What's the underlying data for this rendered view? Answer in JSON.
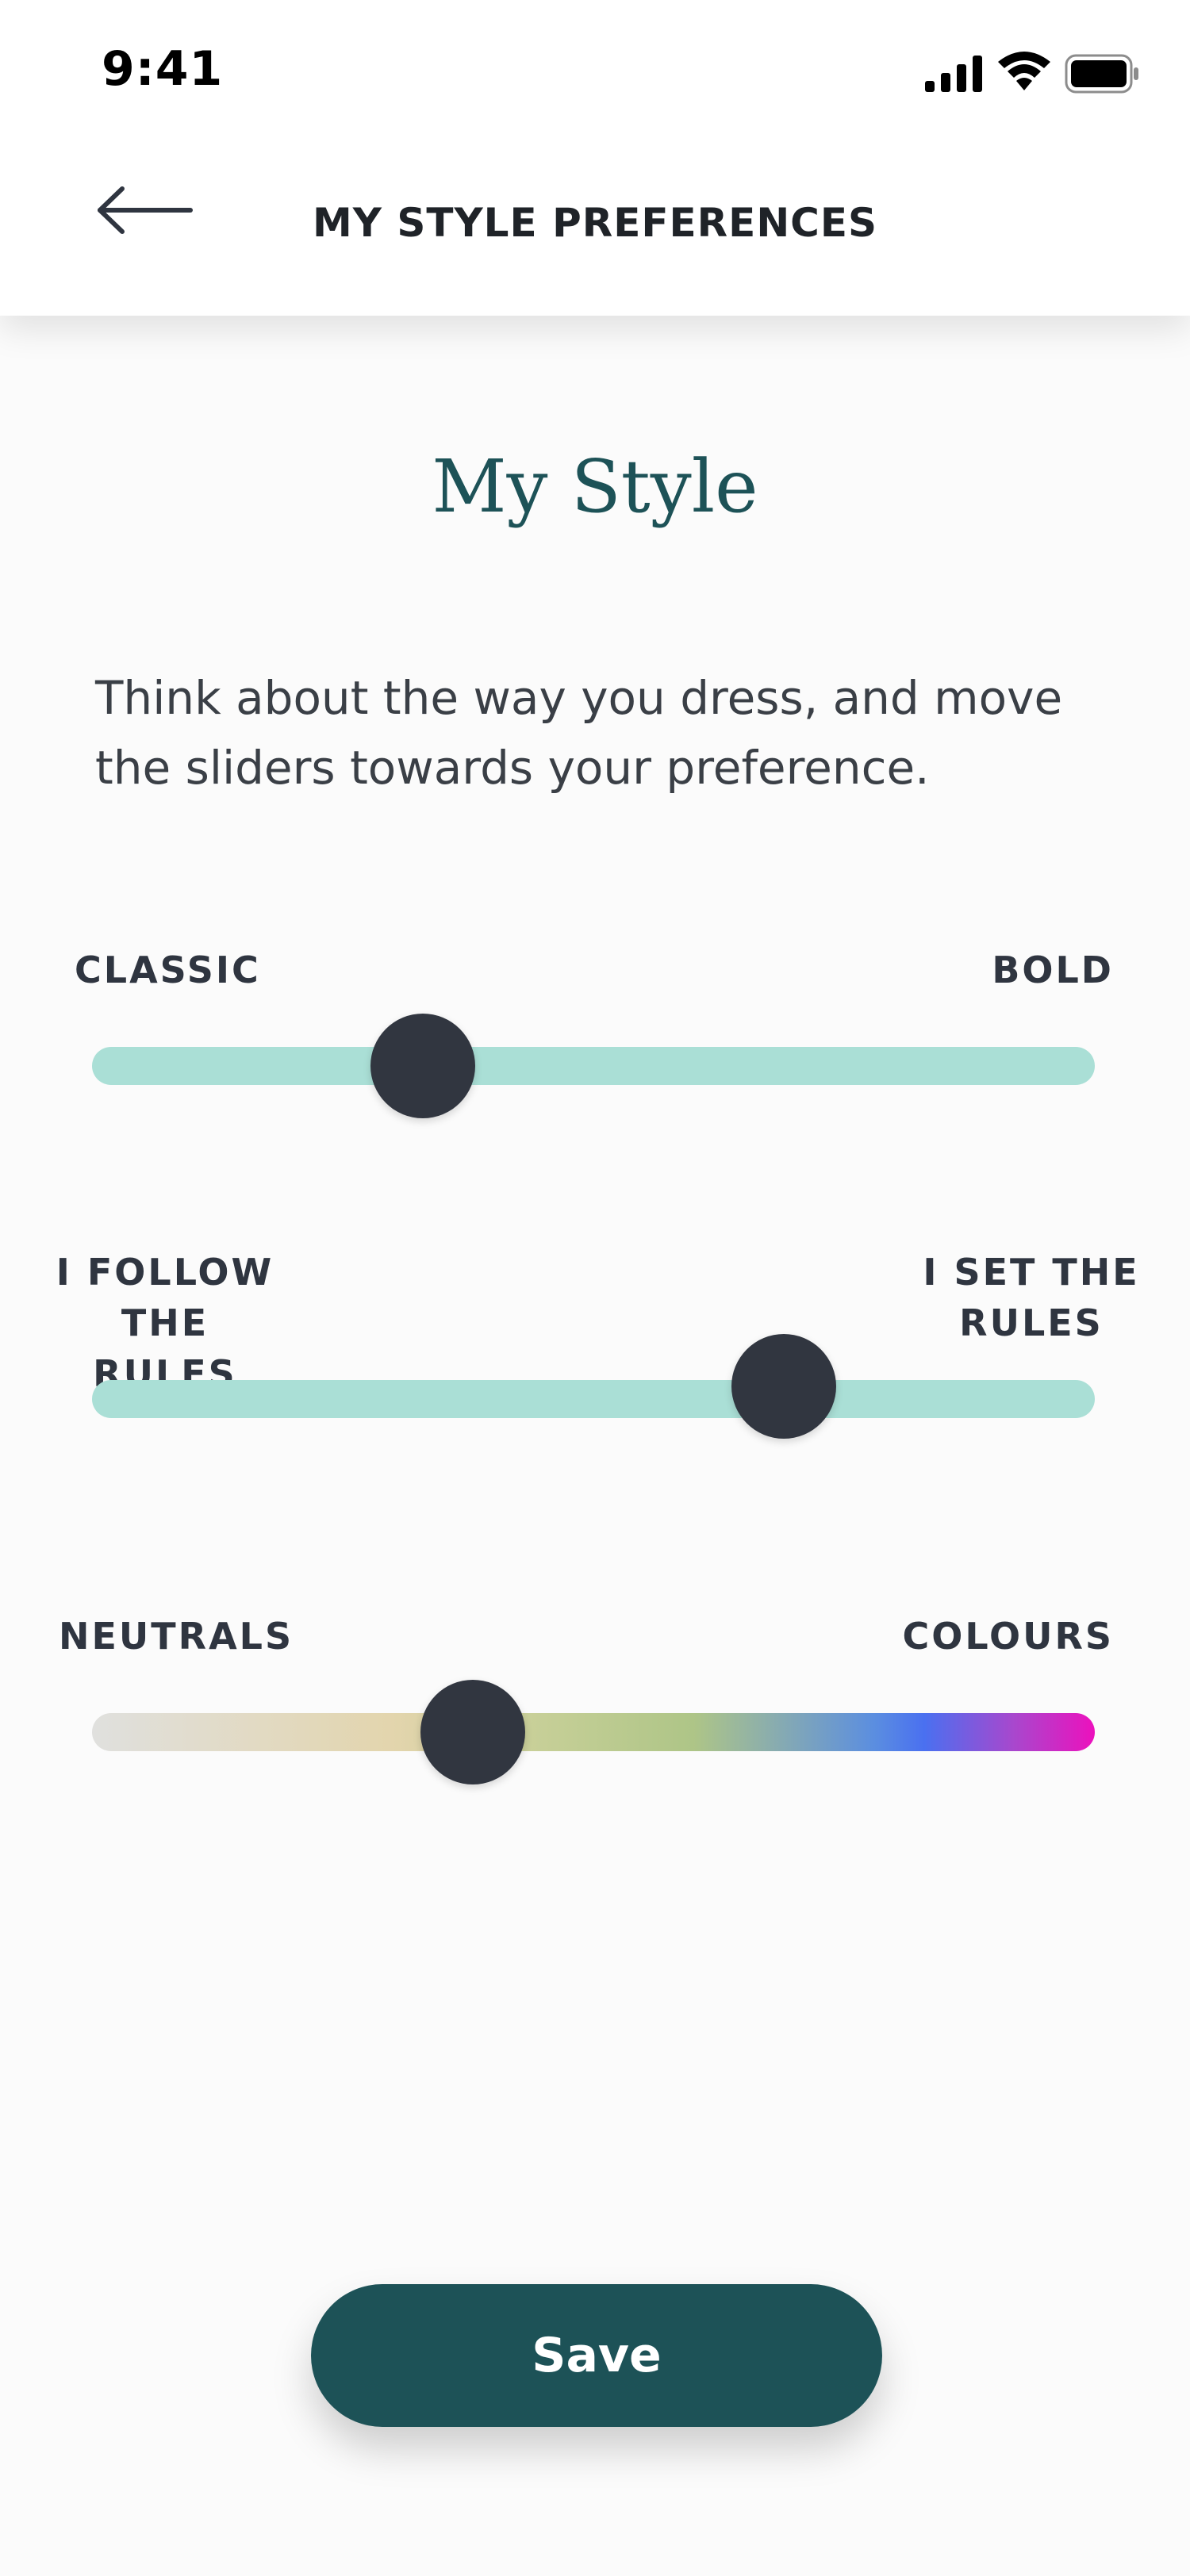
{
  "status_bar": {
    "time": "9:41",
    "icons": [
      "signal-icon",
      "wifi-icon",
      "battery-icon"
    ]
  },
  "header": {
    "title": "MY STYLE PREFERENCES",
    "back_icon": "arrow-left-icon"
  },
  "main": {
    "section_title": "My Style",
    "intro_line1": "Think about the way you dress, and move",
    "intro_line2": "the sliders towards your preference."
  },
  "sliders": [
    {
      "left_label": "CLASSIC",
      "right_label": "BOLD",
      "value_percent": 33
    },
    {
      "left_label_line1": "I FOLLOW",
      "left_label_line2": "THE RULES",
      "right_label_line1": "I SET THE",
      "right_label_line2": "RULES",
      "value_percent": 69
    },
    {
      "left_label": "NEUTRALS",
      "right_label": "COLOURS",
      "value_percent": 38,
      "gradient_colors": [
        "#e0e0de",
        "#e3d5ad",
        "#aec587",
        "#4a70f0",
        "#ec11bd"
      ]
    }
  ],
  "actions": {
    "save_label": "Save"
  },
  "colors": {
    "accent": "#1d5257",
    "track": "#aadfd6",
    "thumb": "#313640"
  }
}
